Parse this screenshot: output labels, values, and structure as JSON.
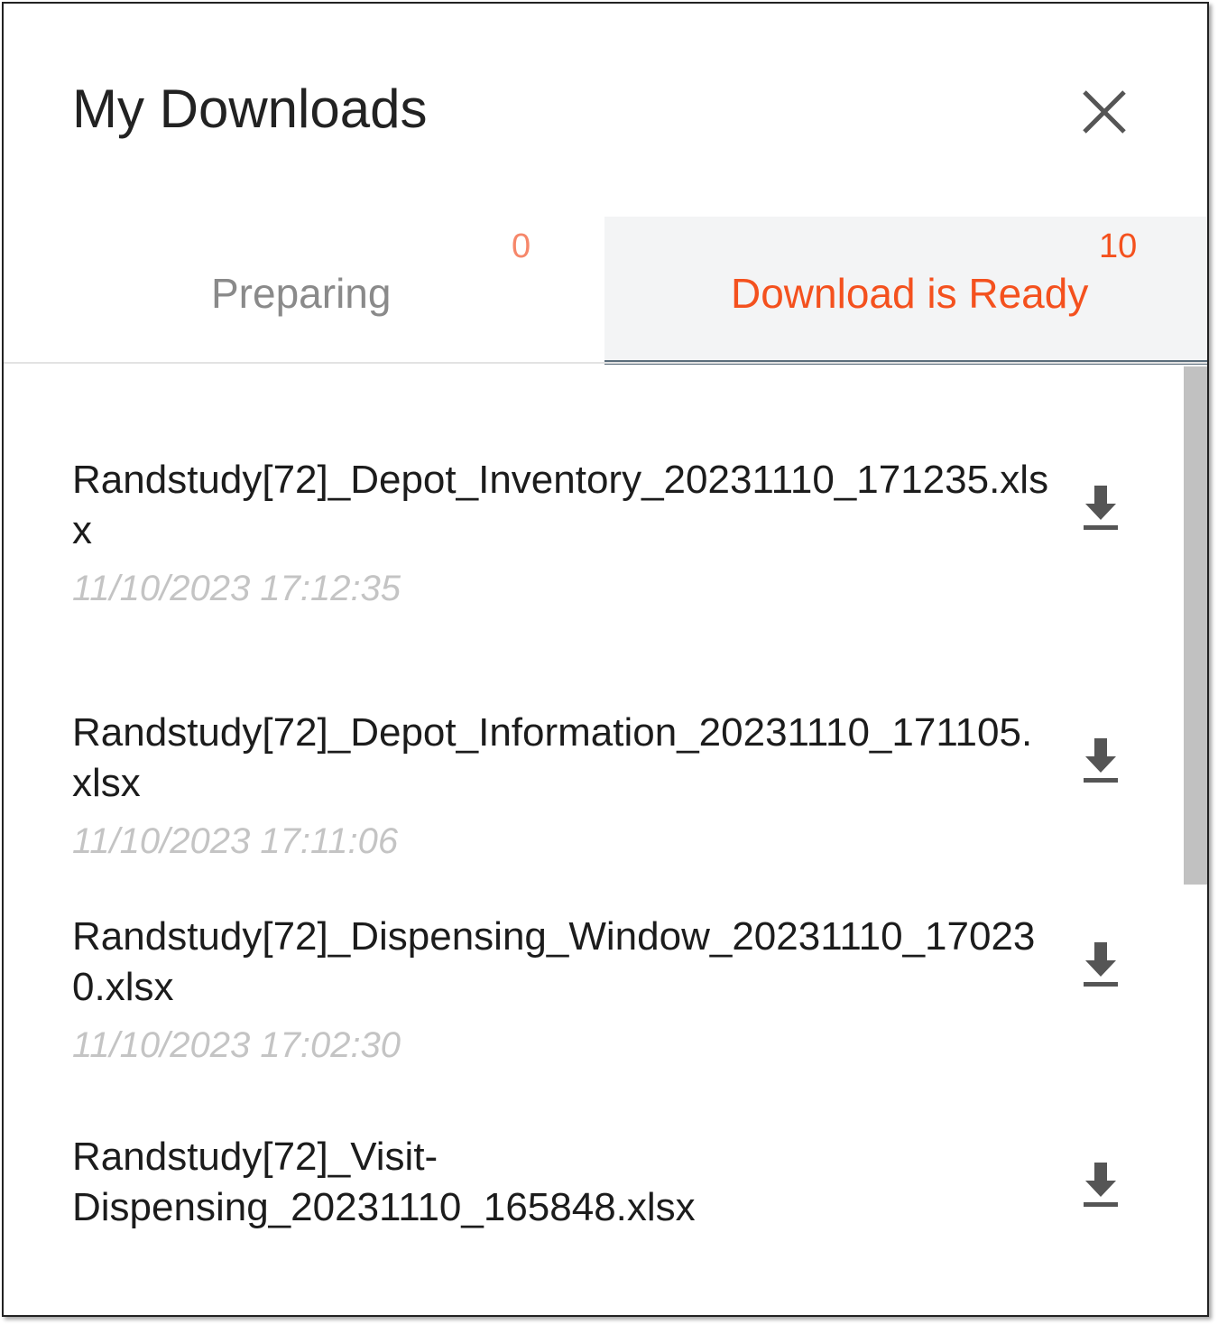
{
  "header": {
    "title": "My Downloads",
    "close_icon": "close-icon"
  },
  "tabs": [
    {
      "label": "Preparing",
      "count": "0",
      "active": false
    },
    {
      "label": "Download is Ready",
      "count": "10",
      "active": true
    }
  ],
  "downloads": [
    {
      "filename": "Randstudy[72]_Depot_Inventory_20231110_171235.xlsx",
      "timestamp": "11/10/2023 17:12:35",
      "icon": "download-icon"
    },
    {
      "filename": "Randstudy[72]_Depot_Information_20231110_171105.xlsx",
      "timestamp": "11/10/2023 17:11:06",
      "icon": "download-icon"
    },
    {
      "filename": "Randstudy[72]_Dispensing_Window_20231110_170230.xlsx",
      "timestamp": "11/10/2023 17:02:30",
      "icon": "download-icon"
    },
    {
      "filename": "Randstudy[72]_Visit-Dispensing_20231110_165848.xlsx",
      "timestamp": "",
      "icon": "download-icon"
    }
  ],
  "colors": {
    "accent": "#f4511e",
    "tab_indicator": "#5b6d7b",
    "active_tab_bg": "#f3f4f5"
  }
}
